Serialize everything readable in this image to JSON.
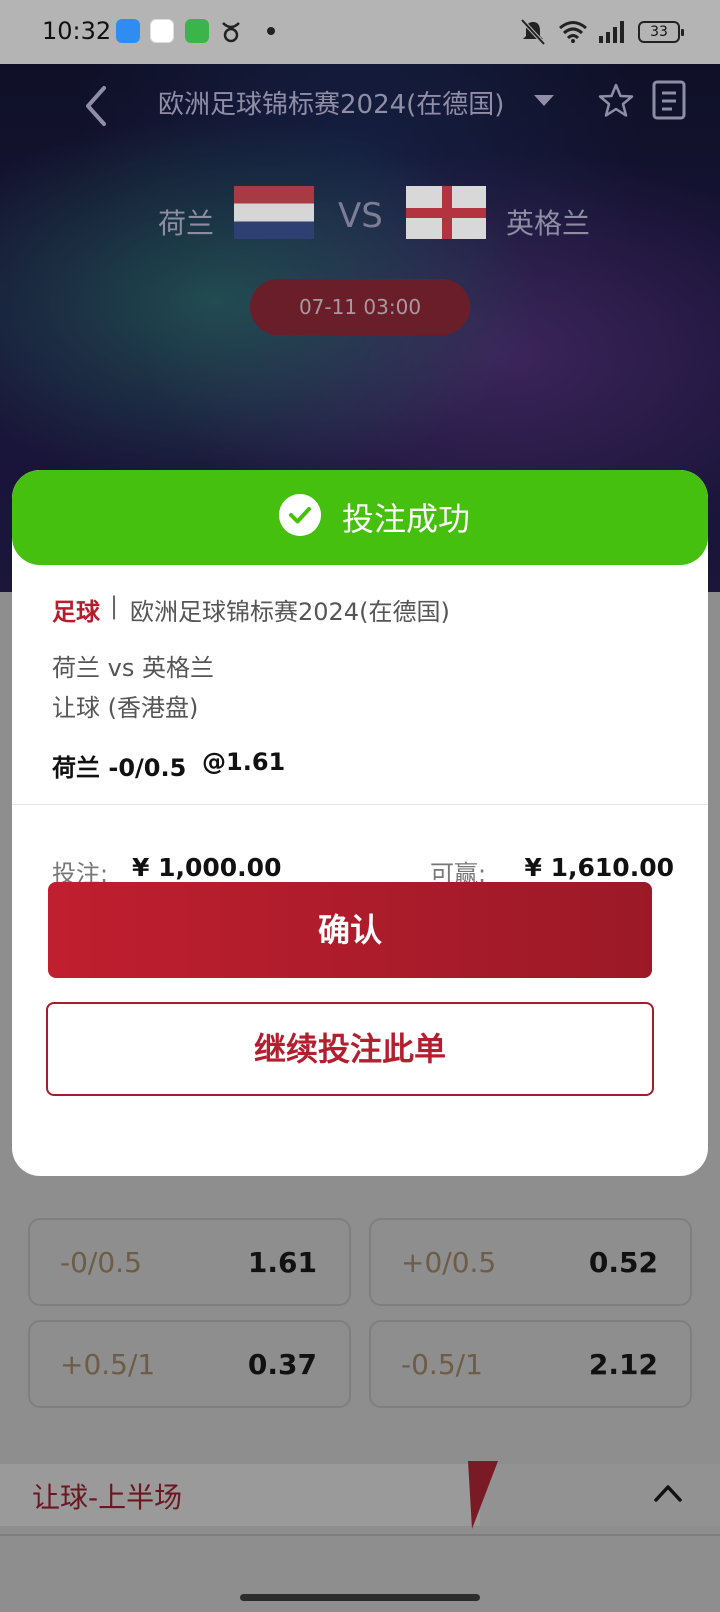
{
  "status_bar": {
    "time": "10:32",
    "battery": "33"
  },
  "header": {
    "title": "欧洲足球锦标赛2024(在德国)",
    "home_team": "荷兰",
    "away_team": "英格兰",
    "vs": "VS",
    "kickoff": "07-11 03:00"
  },
  "modal": {
    "title": "投注成功",
    "sport": "足球",
    "separator": "|",
    "league": "欧洲足球锦标赛2024(在德国)",
    "matchup": "荷兰 vs 英格兰",
    "market": "让球 (香港盘)",
    "selection": "荷兰 -0/0.5",
    "odds": "@1.61",
    "stake_label": "投注:",
    "stake_value": "¥ 1,000.00",
    "win_label": "可赢:",
    "win_value": "¥ 1,610.00",
    "confirm_label": "确认",
    "continue_label": "继续投注此单"
  },
  "odds_grid": [
    {
      "line": "-0/0.5",
      "odd": "1.61"
    },
    {
      "line": "+0/0.5",
      "odd": "0.52"
    },
    {
      "line": "+0.5/1",
      "odd": "0.37"
    },
    {
      "line": "-0.5/1",
      "odd": "2.12"
    }
  ],
  "section": {
    "title": "让球-上半场"
  },
  "colors": {
    "success_green": "#46c00e",
    "brand_red": "#b51f2d"
  }
}
